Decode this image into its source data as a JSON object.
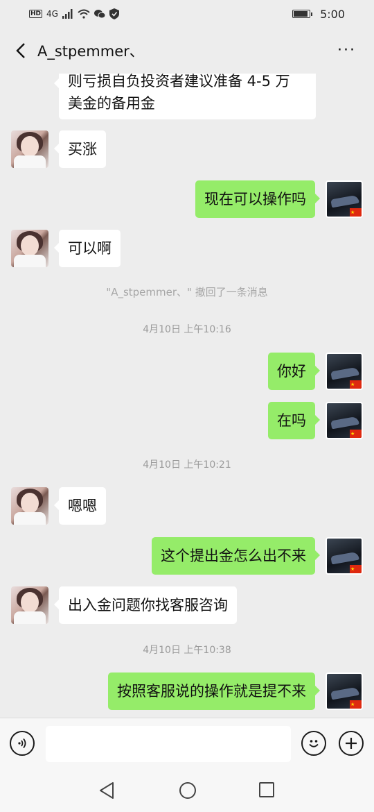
{
  "status_bar": {
    "hd": "HD",
    "network": "4G",
    "time": "5:00"
  },
  "header": {
    "title": "A_stpemmer、",
    "more": "···"
  },
  "messages": [
    {
      "side": "left",
      "text_line1": "则亏损自负投资者建议准备 4-5 万",
      "text_line2": "美金的备用金"
    },
    {
      "side": "left",
      "text": "买涨"
    },
    {
      "side": "right",
      "text": "现在可以操作吗"
    },
    {
      "side": "left",
      "text": "可以啊"
    },
    {
      "system": "\"A_stpemmer、\" 撤回了一条消息"
    },
    {
      "time": "4月10日 上午10:16"
    },
    {
      "side": "right",
      "text": "你好"
    },
    {
      "side": "right",
      "text": "在吗"
    },
    {
      "time": "4月10日 上午10:21"
    },
    {
      "side": "left",
      "text": "嗯嗯"
    },
    {
      "side": "right",
      "text": "这个提出金怎么出不来"
    },
    {
      "side": "left",
      "text": "出入金问题你找客服咨询"
    },
    {
      "time": "4月10日 上午10:38"
    },
    {
      "side": "right",
      "text": "按照客服说的操作就是提不来"
    }
  ],
  "input": {
    "value": "",
    "placeholder": ""
  },
  "colors": {
    "background": "#ededed",
    "bubble_self": "#95ec69",
    "bubble_other": "#ffffff"
  }
}
